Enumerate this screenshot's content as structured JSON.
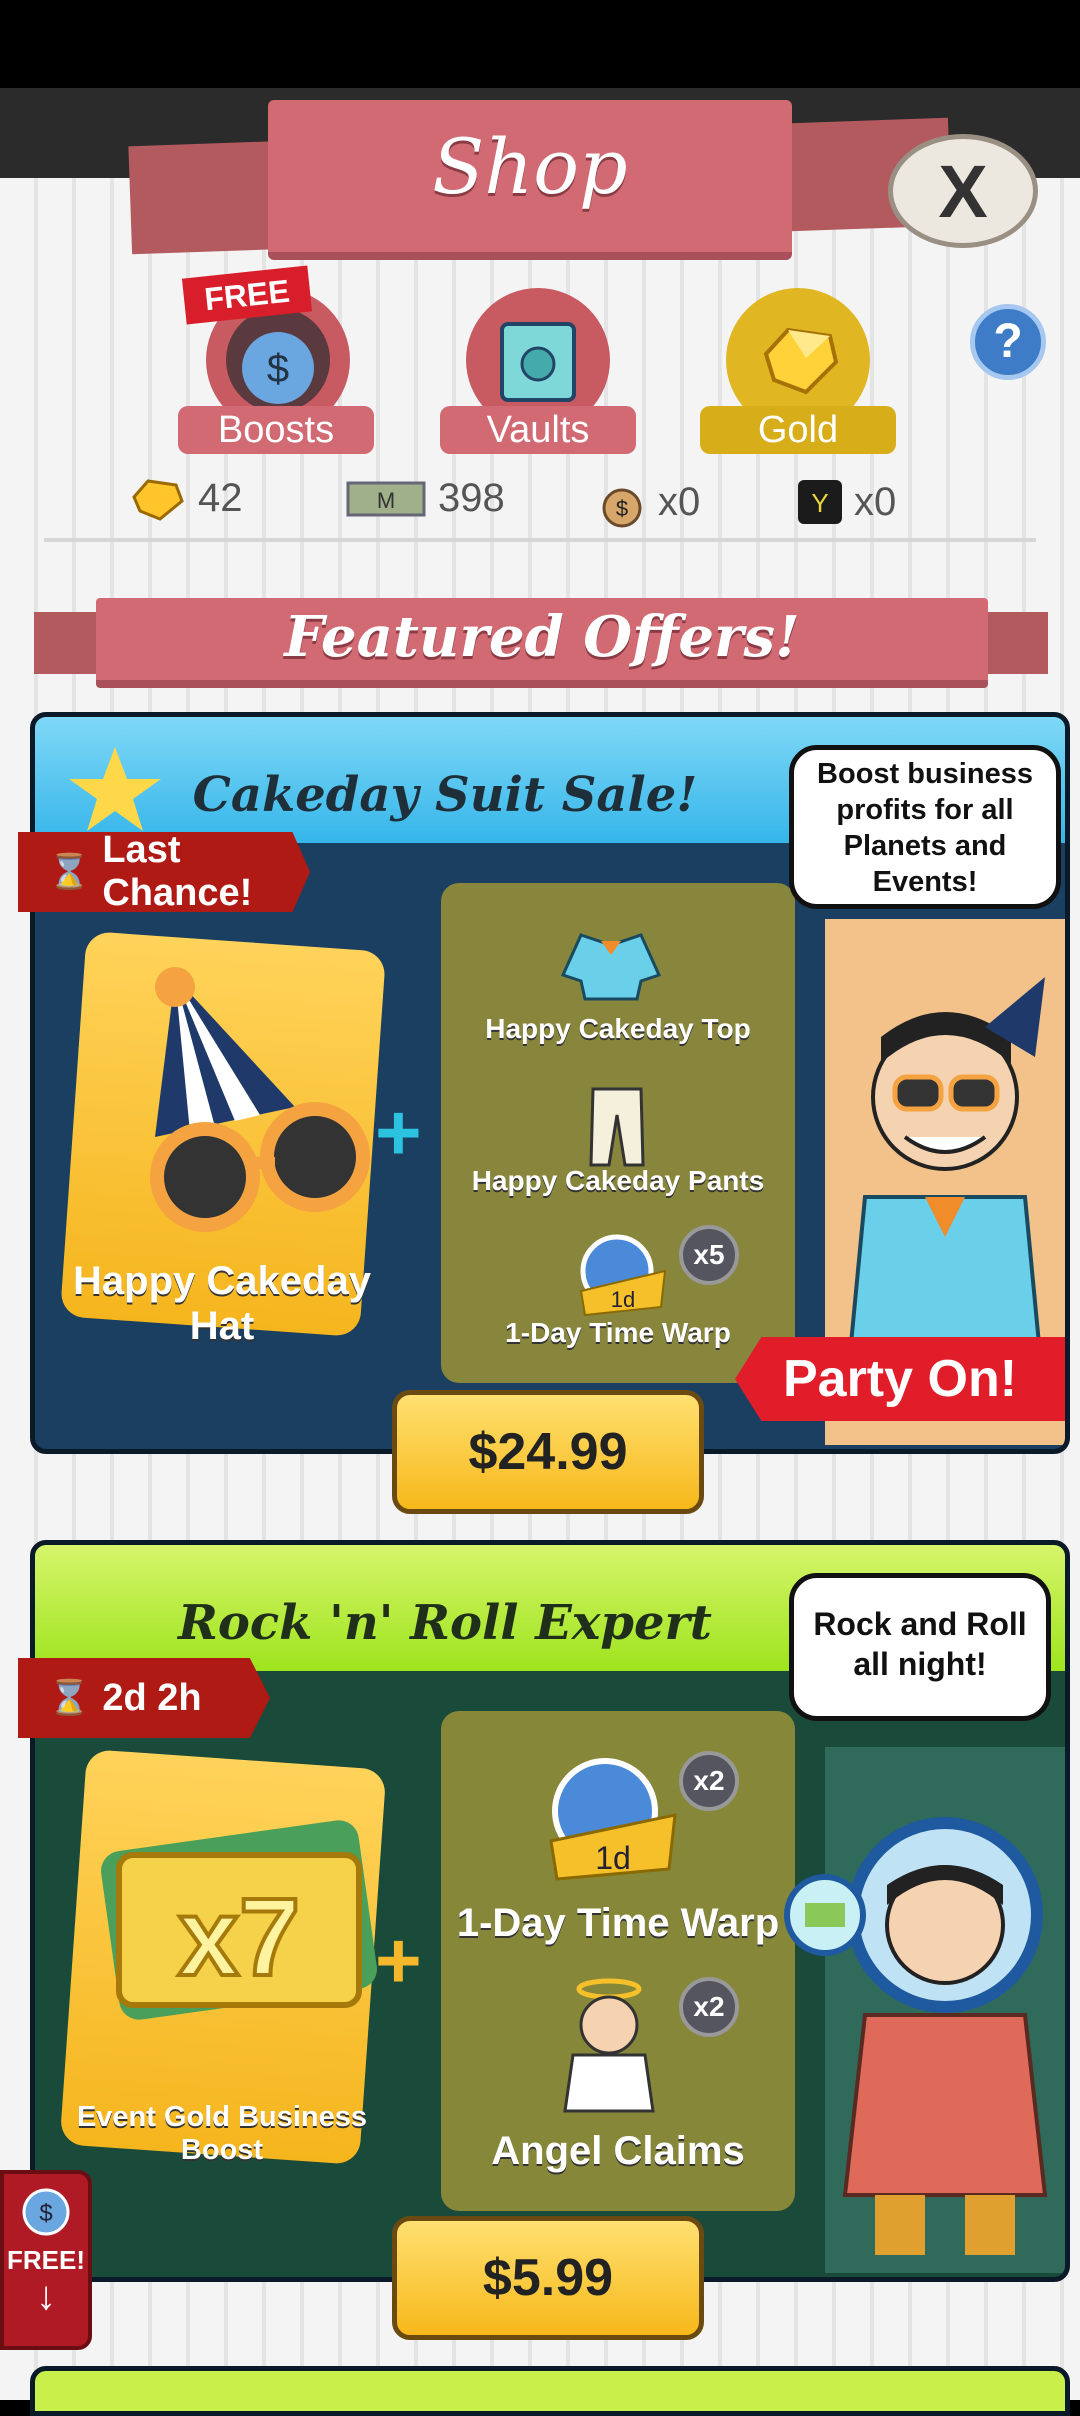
{
  "header": {
    "title": "Shop",
    "close_label": "X"
  },
  "categories": [
    {
      "label": "Boosts",
      "badge": "FREE",
      "color": "#d16a72"
    },
    {
      "label": "Vaults",
      "color": "#d16a72"
    },
    {
      "label": "Gold",
      "color": "#d7ad19"
    }
  ],
  "help_label": "?",
  "currencies": [
    {
      "icon": "gold-gem-icon",
      "value": "42"
    },
    {
      "icon": "megabucks-icon",
      "value": "398"
    },
    {
      "icon": "money-bag-icon",
      "value": "x0"
    },
    {
      "icon": "ticket-icon",
      "value": "x0"
    }
  ],
  "featured_title": "Featured Offers!",
  "offers": [
    {
      "title": "Cakeday Suit Sale!",
      "timer": "Last Chance!",
      "main_item": "Happy Cakeday Hat",
      "items": [
        {
          "label": "Happy Cakeday Top"
        },
        {
          "label": "Happy Cakeday Pants"
        },
        {
          "label": "1-Day Time Warp",
          "count": "x5"
        }
      ],
      "bubble": "Boost business profits for all Planets and Events!",
      "banner": "Party On!",
      "price": "$24.99"
    },
    {
      "title": "Rock 'n' Roll Expert",
      "timer": "2d 2h",
      "main_item": "Event Gold Business Boost",
      "main_multiplier": "x7",
      "items": [
        {
          "label": "1-Day Time Warp",
          "count": "x2"
        },
        {
          "label": "Angel Claims",
          "count": "x2"
        }
      ],
      "bubble": "Rock and Roll all night!",
      "price": "$5.99"
    }
  ],
  "free_tab": {
    "label": "FREE!"
  }
}
